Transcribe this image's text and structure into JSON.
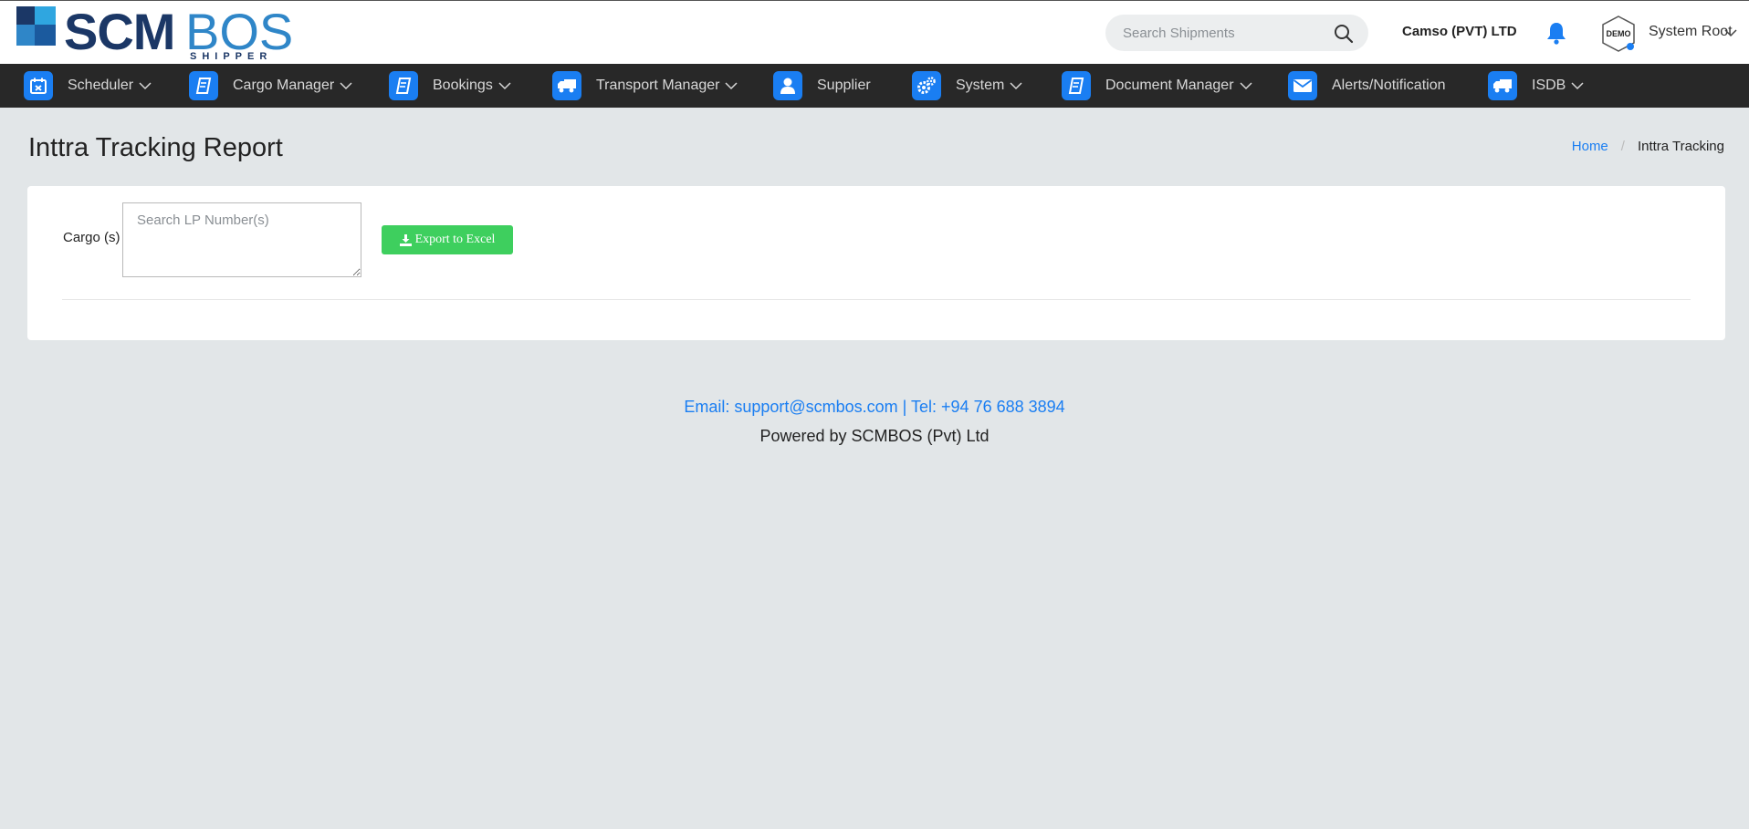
{
  "header": {
    "logo": {
      "word1": "SCM",
      "word2": "BOS",
      "tagline": "SHIPPER"
    },
    "search_placeholder": "Search Shipments",
    "company": "Camso (PVT) LTD",
    "avatar_text": "DEMO",
    "user_name": "System Root"
  },
  "nav": {
    "items": [
      {
        "label": "Scheduler",
        "icon": "calendar-icon",
        "dropdown": true
      },
      {
        "label": "Cargo Manager",
        "icon": "book-icon",
        "dropdown": true
      },
      {
        "label": "Bookings",
        "icon": "book-icon",
        "dropdown": true
      },
      {
        "label": "Transport Manager",
        "icon": "truck-icon",
        "dropdown": true
      },
      {
        "label": "Supplier",
        "icon": "user-icon",
        "dropdown": false
      },
      {
        "label": "System",
        "icon": "gears-icon",
        "dropdown": true
      },
      {
        "label": "Document Manager",
        "icon": "book-icon",
        "dropdown": true
      },
      {
        "label": "Alerts/Notification",
        "icon": "envelope-icon",
        "dropdown": false
      },
      {
        "label": "ISDB",
        "icon": "truck-icon",
        "dropdown": true
      }
    ]
  },
  "page": {
    "title": "Inttra Tracking Report",
    "breadcrumb": {
      "home": "Home",
      "current": "Inttra Tracking"
    }
  },
  "form": {
    "cargo_label": "Cargo (s)",
    "cargo_placeholder": "Search LP Number(s)",
    "cargo_value": "",
    "export_label": "Export to Excel"
  },
  "footer": {
    "contact": "Email: support@scmbos.com | Tel: +94 76 688 3894",
    "powered": "Powered by SCMBOS (Pvt) Ltd"
  },
  "colors": {
    "brand_dark": "#1b3766",
    "brand_light": "#2f86c8",
    "accent_blue": "#1a7ef2",
    "nav_bg": "#282828",
    "export_green": "#3ecf5e",
    "page_bg": "#e2e6e8"
  }
}
